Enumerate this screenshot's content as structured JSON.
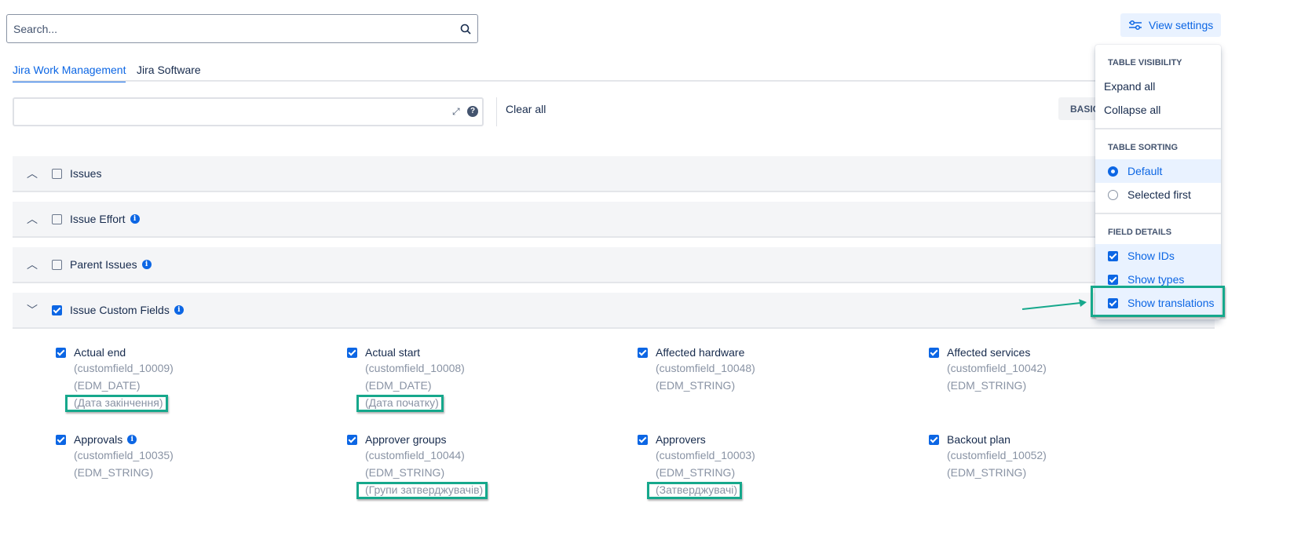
{
  "search": {
    "placeholder": "Search..."
  },
  "tabs": [
    {
      "label": "Jira Work Management",
      "active": true
    },
    {
      "label": "Jira Software",
      "active": false
    }
  ],
  "query": {
    "clear_all": "Clear all",
    "basic": "BASIC"
  },
  "sections": [
    {
      "label": "Issues",
      "expanded": true,
      "checked": false,
      "info": false
    },
    {
      "label": "Issue Effort",
      "expanded": true,
      "checked": false,
      "info": true
    },
    {
      "label": "Parent Issues",
      "expanded": true,
      "checked": false,
      "info": true
    },
    {
      "label": "Issue Custom Fields",
      "expanded": false,
      "checked": true,
      "info": true
    }
  ],
  "fields": [
    {
      "name": "Actual end",
      "id": "(customfield_10009)",
      "type": "(EDM_DATE)",
      "translation": "(Дата закінчення)",
      "checked": true
    },
    {
      "name": "Actual start",
      "id": "(customfield_10008)",
      "type": "(EDM_DATE)",
      "translation": "(Дата початку)",
      "checked": true
    },
    {
      "name": "Affected hardware",
      "id": "(customfield_10048)",
      "type": "(EDM_STRING)",
      "checked": true
    },
    {
      "name": "Affected services",
      "id": "(customfield_10042)",
      "type": "(EDM_STRING)",
      "checked": true
    },
    {
      "name": "Approvals",
      "id": "(customfield_10035)",
      "type": "(EDM_STRING)",
      "checked": true,
      "info": true
    },
    {
      "name": "Approver groups",
      "id": "(customfield_10044)",
      "type": "(EDM_STRING)",
      "translation": "(Групи затверджувачів)",
      "checked": true
    },
    {
      "name": "Approvers",
      "id": "(customfield_10003)",
      "type": "(EDM_STRING)",
      "translation": "(Затверджувачі)",
      "checked": true
    },
    {
      "name": "Backout plan",
      "id": "(customfield_10052)",
      "type": "(EDM_STRING)",
      "checked": true
    }
  ],
  "view_settings": {
    "label": "View settings",
    "menu": {
      "visibility_header": "TABLE VISIBILITY",
      "expand_all": "Expand all",
      "collapse_all": "Collapse all",
      "sorting_header": "TABLE SORTING",
      "default": "Default",
      "selected_first": "Selected first",
      "sorting_selected": "Default",
      "details_header": "FIELD DETAILS",
      "show_ids": "Show IDs",
      "show_types": "Show types",
      "show_translations": "Show translations"
    }
  },
  "colors": {
    "accent": "#0c66e4",
    "highlight": "#16a88c"
  }
}
